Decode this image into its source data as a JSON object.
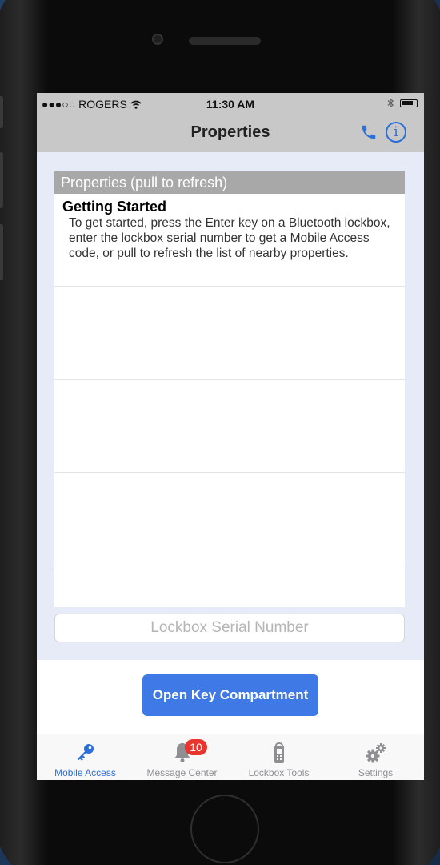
{
  "status_bar": {
    "carrier": "●●●○○ ROGERS",
    "time": "11:30 AM"
  },
  "nav": {
    "title": "Properties",
    "phone_icon": "phone-icon",
    "info_icon": "info-icon",
    "info_glyph": "i"
  },
  "list": {
    "header": "Properties (pull to refresh)",
    "items": [
      {
        "title": "Getting Started",
        "text": "To get started, press the Enter key on a Bluetooth lockbox, enter the lockbox serial number to get a Mobile Access code, or pull to refresh the list of nearby properties."
      }
    ]
  },
  "serial_input": {
    "placeholder": "Lockbox Serial Number",
    "value": ""
  },
  "open_button": {
    "label": "Open Key Compartment"
  },
  "tabs": [
    {
      "label": "Mobile Access",
      "icon": "key-icon",
      "active": true
    },
    {
      "label": "Message Center",
      "icon": "bell-icon",
      "badge": "10"
    },
    {
      "label": "Lockbox Tools",
      "icon": "lockbox-icon"
    },
    {
      "label": "Settings",
      "icon": "gears-icon"
    }
  ],
  "colors": {
    "accent": "#2a6fdb",
    "button": "#3f79e6",
    "badge": "#e8352e",
    "header_bg": "#c8c8c8",
    "content_bg": "#e6ebf7"
  }
}
